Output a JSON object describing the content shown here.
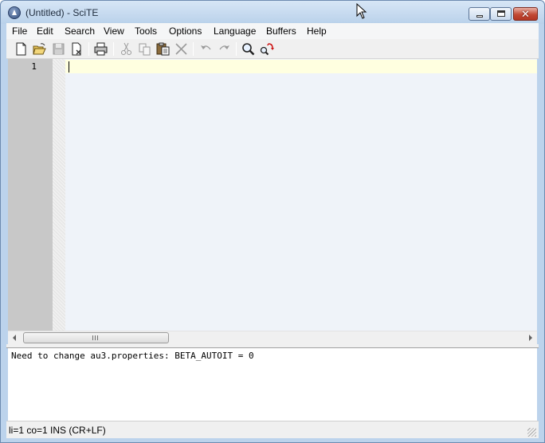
{
  "window": {
    "title": "(Untitled) - SciTE",
    "icons": {
      "app": "scite-app-icon",
      "minimize": "minimize-icon",
      "maximize": "maximize-icon",
      "close": "close-icon"
    },
    "close_glyph": "✕"
  },
  "menu": {
    "items": [
      "File",
      "Edit",
      "Search",
      "View",
      "Tools",
      "Options",
      "Language",
      "Buffers",
      "Help"
    ]
  },
  "toolbar": {
    "buttons": [
      {
        "name": "new",
        "icon": "new-file-icon",
        "enabled": true
      },
      {
        "name": "open",
        "icon": "open-folder-icon",
        "enabled": true
      },
      {
        "name": "save",
        "icon": "save-disk-icon",
        "enabled": false
      },
      {
        "name": "close",
        "icon": "close-file-icon",
        "enabled": true
      },
      {
        "name": "print",
        "icon": "printer-icon",
        "enabled": true
      },
      {
        "name": "cut",
        "icon": "scissors-icon",
        "enabled": false
      },
      {
        "name": "copy",
        "icon": "copy-icon",
        "enabled": false
      },
      {
        "name": "paste",
        "icon": "paste-clipboard-icon",
        "enabled": true
      },
      {
        "name": "delete",
        "icon": "delete-x-icon",
        "enabled": false
      },
      {
        "name": "undo",
        "icon": "undo-icon",
        "enabled": false
      },
      {
        "name": "redo",
        "icon": "redo-icon",
        "enabled": false
      },
      {
        "name": "find",
        "icon": "magnifier-icon",
        "enabled": true
      },
      {
        "name": "replace",
        "icon": "find-replace-icon",
        "enabled": true
      }
    ]
  },
  "editor": {
    "line_numbers": [
      "1"
    ],
    "content": "",
    "current_line_color": "#ffffe0",
    "background_color": "#eff3f9",
    "gutter_color": "#c8c8c8"
  },
  "scrollbar": {
    "grip": "III"
  },
  "output": {
    "text": "Need to change au3.properties: BETA_AUTOIT = 0"
  },
  "statusbar": {
    "text": "li=1 co=1 INS (CR+LF)"
  },
  "colors": {
    "title_bar": "#c4d9ef",
    "close_button": "#c24a35",
    "accent_red": "#cc1111"
  }
}
